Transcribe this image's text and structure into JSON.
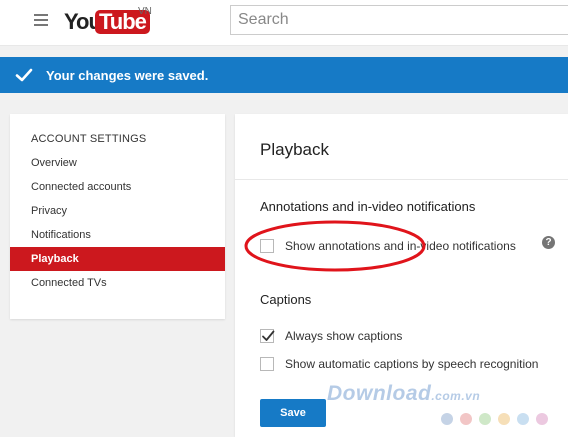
{
  "header": {
    "logo_you": "You",
    "logo_tube": "Tube",
    "logo_region": "VN",
    "search_placeholder": "Search"
  },
  "banner": {
    "message": "Your changes were saved.",
    "color": "#167ac6"
  },
  "sidebar": {
    "title": "ACCOUNT SETTINGS",
    "items": [
      {
        "label": "Overview",
        "active": false
      },
      {
        "label": "Connected accounts",
        "active": false
      },
      {
        "label": "Privacy",
        "active": false
      },
      {
        "label": "Notifications",
        "active": false
      },
      {
        "label": "Playback",
        "active": true
      },
      {
        "label": "Connected TVs",
        "active": false
      }
    ],
    "active_color": "#cc181e"
  },
  "main": {
    "title": "Playback",
    "annotations": {
      "heading": "Annotations and in-video notifications",
      "option_label": "Show annotations and in-video notifications",
      "checked": false,
      "help_icon": "question-circle-icon"
    },
    "captions": {
      "heading": "Captions",
      "options": [
        {
          "label": "Always show captions",
          "checked": true
        },
        {
          "label": "Show automatic captions by speech recognition",
          "checked": false
        }
      ]
    },
    "save_label": "Save"
  },
  "watermark": {
    "text": "Download",
    "suffix": ".com.vn"
  }
}
